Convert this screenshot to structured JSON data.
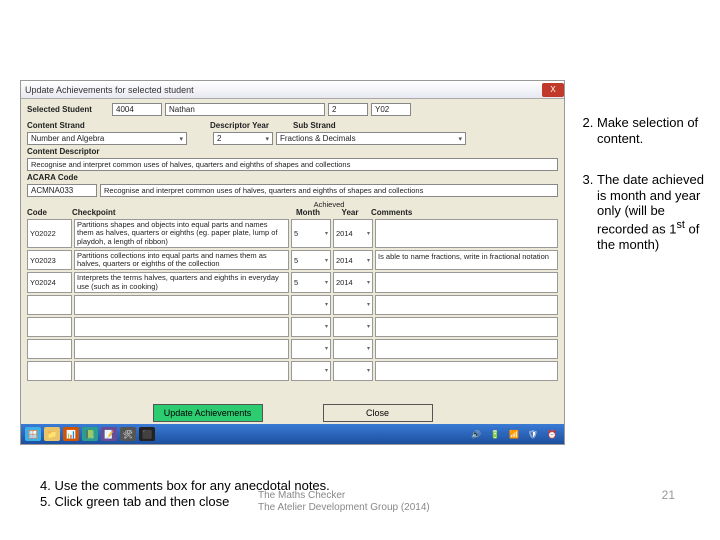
{
  "window": {
    "title": "Update Achievements for selected student",
    "close": "X"
  },
  "student": {
    "label": "Selected Student",
    "id": "4004",
    "name": "Nathan",
    "grade": "2",
    "year": "Y02"
  },
  "content": {
    "strand_label": "Content Strand",
    "strand": "Number and Algebra",
    "desc_year_label": "Descriptor Year",
    "desc_year": "2",
    "sub_label": "Sub Strand",
    "sub": "Fractions & Decimals",
    "descriptor_label": "Content Descriptor",
    "descriptor": "Recognise and interpret common uses of halves, quarters and eighths of shapes and collections",
    "acara_label": "ACARA Code",
    "acara_code": "ACMNA033",
    "acara_text": "Recognise and interpret common uses of halves, quarters and eighths of shapes and collections"
  },
  "table": {
    "achieved": "Achieved",
    "h_code": "Code",
    "h_check": "Checkpoint",
    "h_month": "Month",
    "h_year": "Year",
    "h_comments": "Comments",
    "rows": [
      {
        "code": "Y02022",
        "check": "Partitions shapes and objects into equal parts and names them as halves, quarters or eighths (eg. paper plate, lump of playdoh, a length of ribbon)",
        "month": "5",
        "year": "2014",
        "comment": ""
      },
      {
        "code": "Y02023",
        "check": "Partitions collections into equal parts and names them as halves, quarters or eighths of the collection",
        "month": "5",
        "year": "2014",
        "comment": "Is able to name fractions, write in fractional notation"
      },
      {
        "code": "Y02024",
        "check": "Interprets the terms halves, quarters and eighths in everyday use (such as in cooking)",
        "month": "5",
        "year": "2014",
        "comment": ""
      }
    ],
    "empty1": "",
    "empty2": "",
    "empty3": "",
    "empty4": ""
  },
  "buttons": {
    "update": "Update Achievements",
    "close": "Close"
  },
  "notes": {
    "n2": "Make selection of content.",
    "n3_a": "The date achieved is month and year only (will be recorded as 1",
    "n3_b": "st",
    "n3_c": " of the month)",
    "n4": "4. Use the comments box for any anecdotal notes.",
    "n5": "5. Click green tab and then close",
    "sub_a": "The Maths Checker",
    "sub_b": "The Atelier Development Group (2014)",
    "page": "21"
  },
  "taskbar": {
    "apps": [
      "🪟",
      "📁",
      "📊",
      "📗",
      "📝",
      "🛠",
      "⬛"
    ],
    "tray": [
      "🔊",
      "🔋",
      "📶",
      "🛡",
      "⏰"
    ]
  }
}
